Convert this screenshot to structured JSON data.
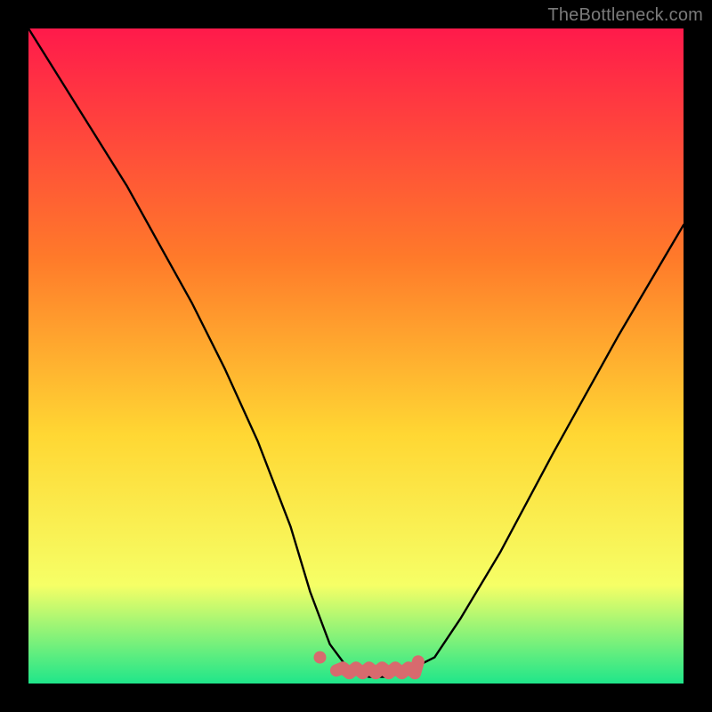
{
  "watermark": "TheBottleneck.com",
  "colors": {
    "bg": "#000000",
    "grad_top": "#ff1a4b",
    "grad_mid1": "#ff7a2a",
    "grad_mid2": "#ffd733",
    "grad_mid3": "#f6ff66",
    "grad_bottom": "#1fe68a",
    "curve": "#000000",
    "marker": "#d86a6e"
  },
  "chart_data": {
    "type": "line",
    "title": "",
    "xlabel": "",
    "ylabel": "",
    "xlim": [
      0,
      100
    ],
    "ylim": [
      0,
      100
    ],
    "series": [
      {
        "name": "bottleneck-curve",
        "x": [
          0,
          5,
          10,
          15,
          20,
          25,
          30,
          35,
          40,
          43,
          46,
          49,
          52,
          55,
          58,
          62,
          66,
          72,
          80,
          90,
          100
        ],
        "y": [
          100,
          92,
          84,
          76,
          67,
          58,
          48,
          37,
          24,
          14,
          6,
          2,
          1,
          1,
          2,
          4,
          10,
          20,
          35,
          53,
          70
        ]
      }
    ],
    "markers": [
      {
        "name": "flat-valley-caterpillar",
        "x_start": 47,
        "x_end": 59,
        "y": 2
      },
      {
        "name": "left-isolated-dot",
        "x": 44.5,
        "y": 4
      }
    ],
    "gradient_stops": [
      {
        "pos": 0.0,
        "color": "#ff1a4b"
      },
      {
        "pos": 0.35,
        "color": "#ff7a2a"
      },
      {
        "pos": 0.62,
        "color": "#ffd733"
      },
      {
        "pos": 0.85,
        "color": "#f6ff66"
      },
      {
        "pos": 1.0,
        "color": "#1fe68a"
      }
    ]
  }
}
